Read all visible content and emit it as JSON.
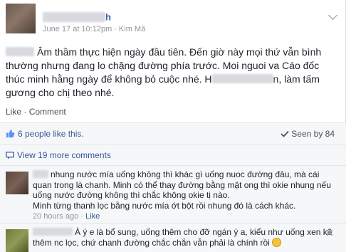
{
  "post": {
    "author_suffix": "h",
    "date": "June 17 at 10:12pm",
    "location": "Kim Mã",
    "text_main": "Âm thầm thực hiện ngày đầu tiên. Đến giờ này mọi thứ vẫn bình thường nhưng đang lo chặng đường phía trước. Moi nguoi va Cáo đốc thúc minh hằng ngày để không bỏ cuộc nhé. H",
    "text_end": "n, làm tấm gương cho chị theo nhé.",
    "actions": {
      "like": "Like",
      "dot": "·",
      "comment": "Comment"
    }
  },
  "likes": {
    "text": "6 people like this.",
    "seen": "Seen by 84"
  },
  "view_more": "View 19 more comments",
  "comments": [
    {
      "text": "nhung nước mía uống không thì khác gì uống nuoc đường đâu, mà cái quan trong là chanh. Minh có thể thay đường bằng mật ong thì okie nhung nếu uống nước đường không thì chắc không okie tị nào.",
      "text2": "Minh từng thanh lọc bằng nước mía ớt bột rồi nhung đó là cách khác.",
      "time": "20 hours ago",
      "dot": "·",
      "like": "Like"
    },
    {
      "text": "À ý e là bổ sung, uống thêm cho đỡ ngán ý a, kiểu như uống xen kẽ thêm nc lọc, chứ chanh đường chắc chắn vẫn phải là chính rồi"
    }
  ],
  "colors": {
    "link": "#365899",
    "meta": "#90949c",
    "text": "#1d2129",
    "panel": "#f6f7f9"
  }
}
